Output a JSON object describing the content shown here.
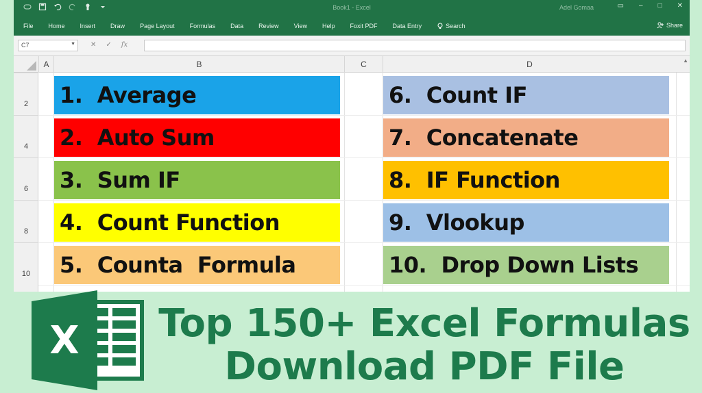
{
  "window": {
    "doc_title": "Book1 - Excel",
    "user_name": "Adel Gomaa"
  },
  "ribbon": {
    "tabs": [
      "File",
      "Home",
      "Insert",
      "Draw",
      "Page Layout",
      "Formulas",
      "Data",
      "Review",
      "View",
      "Help",
      "Foxit PDF",
      "Data Entry"
    ],
    "tell_me": "Search",
    "share": "Share"
  },
  "formula_bar": {
    "name_box": "C7",
    "formula": ""
  },
  "columns": [
    "A",
    "B",
    "C",
    "D"
  ],
  "rows": [
    "2",
    "4",
    "6",
    "8",
    "10"
  ],
  "formulas_left": [
    {
      "label": "1.  Average",
      "color": "#1aa3e8"
    },
    {
      "label": "2.  Auto Sum",
      "color": "#ff0000"
    },
    {
      "label": "3.  Sum IF",
      "color": "#8ac24b"
    },
    {
      "label": "4.  Count Function",
      "color": "#ffff00"
    },
    {
      "label": "5.  Counta  Formula",
      "color": "#fbc878"
    }
  ],
  "formulas_right": [
    {
      "label": "6.  Count IF",
      "color": "#a9c0e2"
    },
    {
      "label": "7.  Concatenate",
      "color": "#f2ad87"
    },
    {
      "label": "8.  IF Function",
      "color": "#ffc000"
    },
    {
      "label": "9.  Vlookup",
      "color": "#9dc0e6"
    },
    {
      "label": "10.  Drop Down Lists",
      "color": "#a9d08e"
    }
  ],
  "banner": {
    "logo_letter": "X",
    "line1": "Top 150+ Excel Formulas",
    "line2": "Download PDF File",
    "text_color": "#1d7b4c",
    "logo_color": "#1d7b4c"
  }
}
